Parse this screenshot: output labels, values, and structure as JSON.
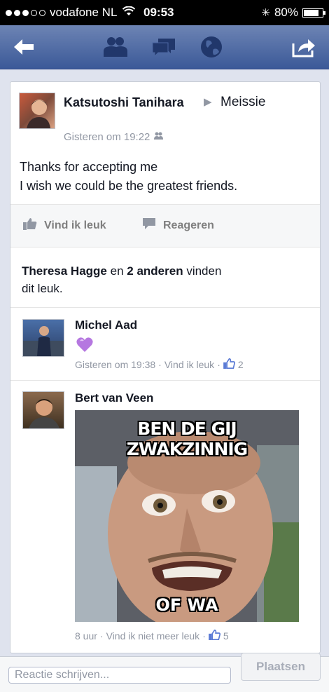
{
  "status_bar": {
    "carrier": "vodafone NL",
    "time": "09:53",
    "battery": "80%",
    "battery_level": 0.8
  },
  "nav": {
    "back_icon": "back-arrow-icon",
    "friends_icon": "friend-requests-icon",
    "messages_icon": "messages-icon",
    "notifications_icon": "globe-icon",
    "share_icon": "share-icon"
  },
  "post": {
    "author": "Katsutoshi Tanihara",
    "recipient": "Meissie",
    "timestamp": "Gisteren om 19:22",
    "text_line1": "Thanks for accepting me",
    "text_line2": "I wish we could be the greatest friends.",
    "like_label": "Vind ik leuk",
    "comment_label": "Reageren"
  },
  "likes_summary": {
    "name": "Theresa Hagge",
    "connector": "en",
    "others": "2 anderen",
    "suffix_line1": "vinden",
    "suffix_line2": "dit leuk."
  },
  "comments": [
    {
      "author": "Michel Aad",
      "time": "Gisteren om 19:38",
      "like_label": "Vind ik leuk",
      "like_count": "2"
    },
    {
      "author": "Bert van Veen",
      "meme_top": "BEN DE GIJ ZWAKZINNIG",
      "meme_bottom": "OF WA",
      "time": "8 uur",
      "like_label": "Vind ik niet meer leuk",
      "like_count": "5"
    }
  ],
  "composer": {
    "placeholder": "Reactie schrijven...",
    "submit_label": "Plaatsen"
  },
  "colors": {
    "brand": "#3b5998",
    "link_like": "#5b7bd5",
    "muted": "#9197a3"
  }
}
